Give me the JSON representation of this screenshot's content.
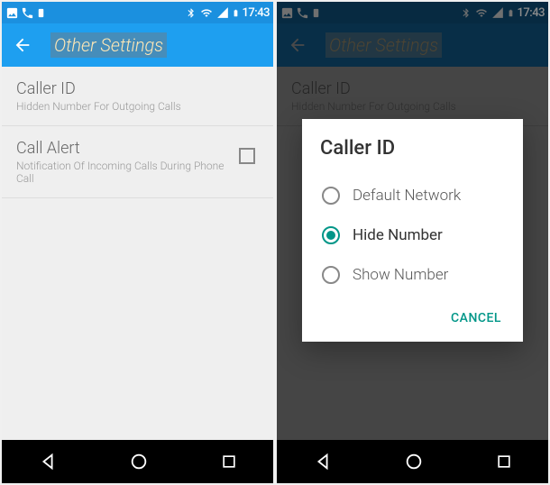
{
  "status": {
    "time": "17:43"
  },
  "appbar": {
    "title": "Other Settings"
  },
  "settings": {
    "caller_id": {
      "title": "Caller ID",
      "sub": "Hidden Number For Outgoing Calls"
    },
    "call_alert": {
      "title": "Call Alert",
      "sub": "Notification Of Incoming Calls During Phone Call"
    }
  },
  "dialog": {
    "title": "Caller ID",
    "options": {
      "default": "Default Network",
      "hide": "Hide Number",
      "show": "Show Number"
    },
    "cancel": "CANCEL"
  }
}
